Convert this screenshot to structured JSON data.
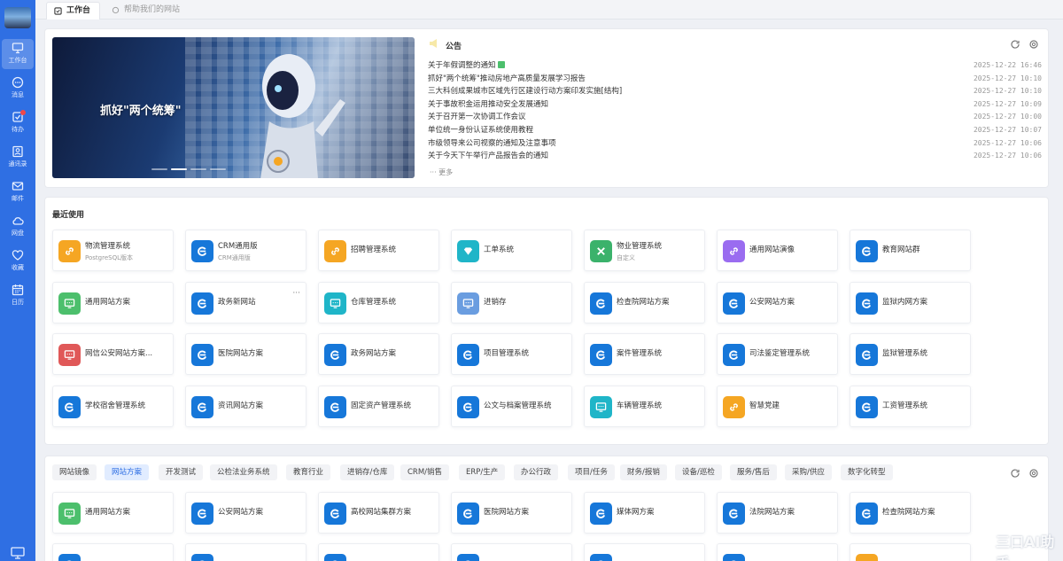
{
  "sidebar": {
    "items": [
      {
        "label": "工作台",
        "icon": "monitor-icon",
        "active": true
      },
      {
        "label": "消息",
        "icon": "chat-icon"
      },
      {
        "label": "待办",
        "icon": "todo-icon",
        "badge": true
      },
      {
        "label": "通讯录",
        "icon": "contacts-icon"
      },
      {
        "label": "邮件",
        "icon": "mail-icon"
      },
      {
        "label": "网盘",
        "icon": "cloud-icon"
      },
      {
        "label": "收藏",
        "icon": "heart-icon"
      },
      {
        "label": "日历",
        "icon": "calendar-icon"
      }
    ]
  },
  "tabs": [
    {
      "label": "工作台",
      "active": true
    },
    {
      "label": "帮助我们的网站"
    }
  ],
  "banner": {
    "text": "抓好\"两个统筹\""
  },
  "notice": {
    "title": "公告",
    "more_label": "更多",
    "items": [
      {
        "title": "关于年假调整的通知",
        "date": "2025-12-22 16:46",
        "is_new": true
      },
      {
        "title": "抓好\"两个统筹\"推动房地产高质量发展学习报告",
        "date": "2025-12-27 10:10"
      },
      {
        "title": "三大科创成果城市区域先行区建设行动方案印发实施[结构]",
        "date": "2025-12-27 10:10"
      },
      {
        "title": "关于事故积金运用推动安全发展通知",
        "date": "2025-12-27 10:09"
      },
      {
        "title": "关于召开第一次协调工作会议",
        "date": "2025-12-27 10:00"
      },
      {
        "title": "单位统一身份认证系统使用教程",
        "date": "2025-12-27 10:07"
      },
      {
        "title": "市级领导来公司视察的通知及注意事项",
        "date": "2025-12-27 10:06"
      },
      {
        "title": "关于今天下午举行产品报告会的通知",
        "date": "2025-12-27 10:06"
      }
    ]
  },
  "recent": {
    "title": "最近使用",
    "apps": [
      {
        "name": "物流管理系统",
        "sub": "PostgreSQL版本",
        "icon": "link-icon",
        "color": "#f5a623"
      },
      {
        "name": "CRM通用版",
        "sub": "CRM通用版",
        "icon": "e-icon",
        "color": "#1677d9"
      },
      {
        "name": "招聘管理系统",
        "icon": "link-icon",
        "color": "#f5a623"
      },
      {
        "name": "工单系统",
        "icon": "diamond-icon",
        "color": "#1fb5c8"
      },
      {
        "name": "物业管理系统",
        "sub": "自定义",
        "icon": "tools-icon",
        "color": "#3bb26b"
      },
      {
        "name": "通用网站演像",
        "icon": "link-icon",
        "color": "#9a6cf0"
      },
      {
        "name": "教育网站群",
        "icon": "e-icon",
        "color": "#1677d9"
      },
      {
        "name": "通用网站方案",
        "icon": "screen-icon",
        "color": "#4cbf6c"
      },
      {
        "name": "政务新网站",
        "icon": "e-icon",
        "color": "#1677d9",
        "more": true
      },
      {
        "name": "仓库管理系统",
        "icon": "screen-icon",
        "color": "#1fb5c8"
      },
      {
        "name": "进销存",
        "icon": "screen-icon",
        "color": "#6a9de0"
      },
      {
        "name": "检查院网站方案",
        "icon": "e-icon",
        "color": "#1677d9"
      },
      {
        "name": "公安网站方案",
        "icon": "e-icon",
        "color": "#1677d9"
      },
      {
        "name": "监狱内网方案",
        "icon": "e-icon",
        "color": "#1677d9"
      },
      {
        "name": "网信公安网站方案...",
        "icon": "screen-icon",
        "color": "#e05858"
      },
      {
        "name": "医院网站方案",
        "icon": "e-icon",
        "color": "#1677d9"
      },
      {
        "name": "政务网站方案",
        "icon": "e-icon",
        "color": "#1677d9"
      },
      {
        "name": "项目管理系统",
        "icon": "e-icon",
        "color": "#1677d9"
      },
      {
        "name": "案件管理系统",
        "icon": "e-icon",
        "color": "#1677d9"
      },
      {
        "name": "司法鉴定管理系统",
        "icon": "e-icon",
        "color": "#1677d9"
      },
      {
        "name": "监狱管理系统",
        "icon": "e-icon",
        "color": "#1677d9"
      },
      {
        "name": "学校宿舍管理系统",
        "icon": "e-icon",
        "color": "#1677d9"
      },
      {
        "name": "资讯网站方案",
        "icon": "e-icon",
        "color": "#1677d9"
      },
      {
        "name": "固定资产管理系统",
        "icon": "e-icon",
        "color": "#1677d9"
      },
      {
        "name": "公文与档案管理系统",
        "icon": "e-icon",
        "color": "#1677d9"
      },
      {
        "name": "车辆管理系统",
        "icon": "screen-icon",
        "color": "#1fb5c8"
      },
      {
        "name": "智慧党建",
        "icon": "link-icon",
        "color": "#f5a623"
      },
      {
        "name": "工资管理系统",
        "icon": "e-icon",
        "color": "#1677d9"
      }
    ]
  },
  "categories": {
    "tabs": [
      "网站镜像",
      "网站方案",
      "开发测试",
      "公检法业务系统",
      "教育行业",
      "进销存/仓库",
      "CRM/销售",
      "ERP/生产",
      "办公行政",
      "项目/任务",
      "财务/报销",
      "设备/巡检",
      "服务/售后",
      "采购/供应",
      "数字化转型"
    ],
    "active_index": 1,
    "apps": [
      {
        "name": "通用网站方案",
        "icon": "screen-icon",
        "color": "#4cbf6c"
      },
      {
        "name": "公安网站方案",
        "icon": "e-icon",
        "color": "#1677d9"
      },
      {
        "name": "高校网站集群方案",
        "icon": "e-icon",
        "color": "#1677d9"
      },
      {
        "name": "医院网站方案",
        "icon": "e-icon",
        "color": "#1677d9"
      },
      {
        "name": "媒体网方案",
        "icon": "e-icon",
        "color": "#1677d9"
      },
      {
        "name": "法院网站方案",
        "icon": "e-icon",
        "color": "#1677d9"
      },
      {
        "name": "检查院网站方案",
        "icon": "e-icon",
        "color": "#1677d9"
      }
    ],
    "partial_row_colors": [
      "#1677d9",
      "#1677d9",
      "#1677d9",
      "#1677d9",
      "#1677d9",
      "#1677d9",
      "#f5a623"
    ]
  },
  "watermark": "三口AI助手"
}
